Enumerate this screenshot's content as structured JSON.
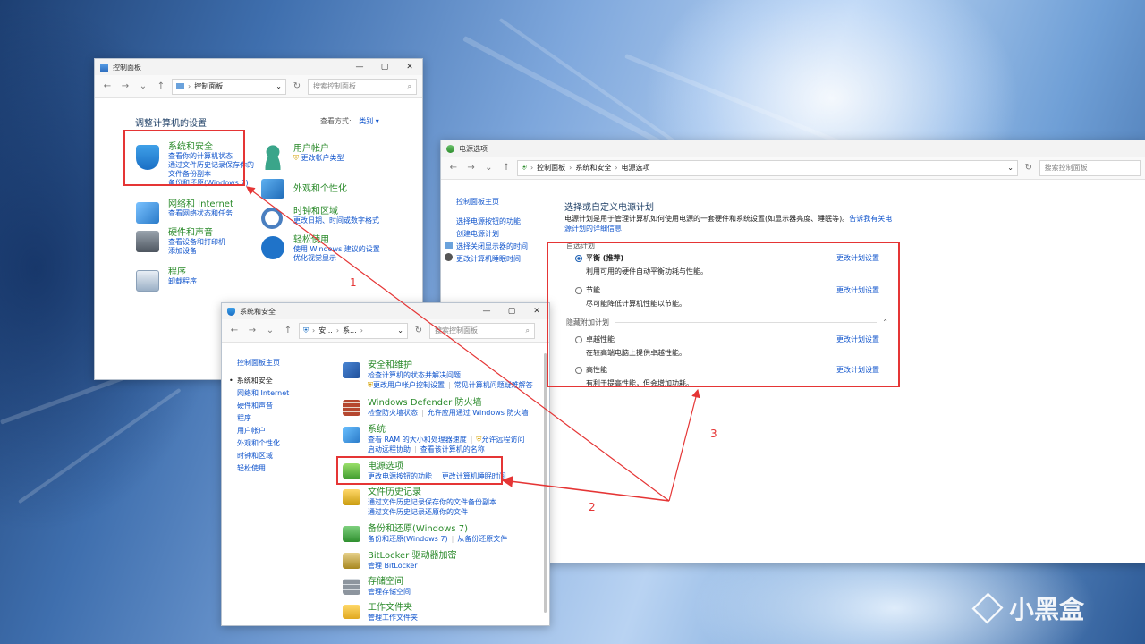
{
  "win1": {
    "title": "控制面板",
    "address": "控制面板",
    "search_placeholder": "搜索控制面板",
    "heading": "调整计算机的设置",
    "view_by_label": "查看方式:",
    "view_by_value": "类别",
    "categories": [
      {
        "title": "系统和安全",
        "links": [
          "查看你的计算机状态",
          "通过文件历史记录保存你的",
          "文件备份副本",
          "备份和还原(Windows 7)"
        ]
      },
      {
        "title": "网络和 Internet",
        "links": [
          "查看网络状态和任务"
        ]
      },
      {
        "title": "硬件和声音",
        "links": [
          "查看设备和打印机",
          "添加设备"
        ]
      },
      {
        "title": "程序",
        "links": [
          "卸载程序"
        ]
      },
      {
        "title": "用户帐户",
        "links": [
          "更改帐户类型"
        ]
      },
      {
        "title": "外观和个性化",
        "links": []
      },
      {
        "title": "时钟和区域",
        "links": [
          "更改日期、时间或数字格式"
        ]
      },
      {
        "title": "轻松使用",
        "links": [
          "使用 Windows 建议的设置",
          "优化视觉显示"
        ]
      }
    ]
  },
  "win2": {
    "title": "电源选项",
    "breadcrumb": [
      "控制面板",
      "系统和安全",
      "电源选项"
    ],
    "search_placeholder": "搜索控制面板",
    "sidebar": [
      "控制面板主页",
      "选择电源按钮的功能",
      "创建电源计划",
      "选择关闭显示器的时间",
      "更改计算机睡眠时间"
    ],
    "heading": "选择或自定义电源计划",
    "desc": "电源计划是用于管理计算机如何使用电源的一套硬件和系统设置(如显示器亮度、睡眠等)。",
    "desc_link": "告诉我有关电源计划的详细信息",
    "section1": "首选计划",
    "section2": "隐藏附加计划",
    "plans": [
      {
        "name": "平衡 (推荐)",
        "desc": "利用可用的硬件自动平衡功耗与性能。",
        "link": "更改计划设置"
      },
      {
        "name": "节能",
        "desc": "尽可能降低计算机性能以节能。",
        "link": "更改计划设置"
      },
      {
        "name": "卓越性能",
        "desc": "在较高端电脑上提供卓越性能。",
        "link": "更改计划设置"
      },
      {
        "name": "高性能",
        "desc": "有利于提高性能，但会增加功耗。",
        "link": "更改计划设置"
      }
    ]
  },
  "win3": {
    "title": "系统和安全",
    "crumb1": "安...",
    "crumb2": "系...",
    "search_placeholder": "搜索控制面板",
    "sidebar": [
      "控制面板主页",
      "系统和安全",
      "网络和 Internet",
      "硬件和声音",
      "程序",
      "用户帐户",
      "外观和个性化",
      "时钟和区域",
      "轻松使用"
    ],
    "items": [
      {
        "title": "安全和维护",
        "l1": [
          "检查计算机的状态并解决问题"
        ],
        "l2": [
          "更改用户帐户控制设置",
          "常见计算机问题疑难解答"
        ]
      },
      {
        "title": "Windows Defender 防火墙",
        "l1": [
          "检查防火墙状态",
          "允许应用通过 Windows 防火墙"
        ],
        "l2": []
      },
      {
        "title": "系统",
        "l1": [
          "查看 RAM 的大小和处理器速度",
          "允许远程访问"
        ],
        "l2": [
          "启动远程协助",
          "查看该计算机的名称"
        ]
      },
      {
        "title": "电源选项",
        "l1": [
          "更改电源按钮的功能",
          "更改计算机睡眠时间"
        ],
        "l2": []
      },
      {
        "title": "文件历史记录",
        "l1": [
          "通过文件历史记录保存你的文件备份副本"
        ],
        "l2": [
          "通过文件历史记录还原你的文件"
        ]
      },
      {
        "title": "备份和还原(Windows 7)",
        "l1": [
          "备份和还原(Windows 7)",
          "从备份还原文件"
        ],
        "l2": []
      },
      {
        "title": "BitLocker 驱动器加密",
        "l1": [
          "管理 BitLocker"
        ],
        "l2": []
      },
      {
        "title": "存储空间",
        "l1": [
          "管理存储空间"
        ],
        "l2": []
      },
      {
        "title": "工作文件夹",
        "l1": [
          "管理工作文件夹"
        ],
        "l2": []
      }
    ]
  },
  "annotations": {
    "n1": "1",
    "n2": "2",
    "n3": "3"
  },
  "watermark": "小黑盒",
  "colors": {
    "annotation": "#e53535",
    "link": "#1155cc",
    "category": "#2a8a2a"
  }
}
